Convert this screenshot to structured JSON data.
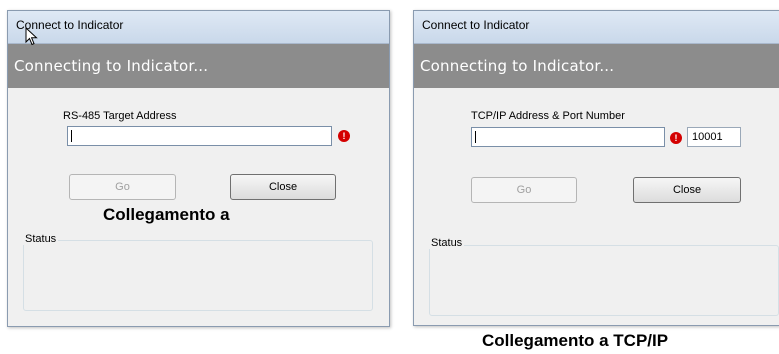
{
  "left_dialog": {
    "title": "Connect to Indicator",
    "header": "Connecting to Indicator...",
    "field_label": "RS-485 Target Address",
    "address_value": "",
    "go_label": "Go",
    "close_label": "Close",
    "status_label": "Status"
  },
  "right_dialog": {
    "title": "Connect to Indicator",
    "header": "Connecting to Indicator...",
    "field_label": "TCP/IP Address & Port Number",
    "address_value": "",
    "port_value": "10001",
    "go_label": "Go",
    "close_label": "Close",
    "status_label": "Status"
  },
  "captions": {
    "left": "Collegamento a",
    "right": "Collegamento a TCP/IP"
  },
  "icons": {
    "error": "error-icon",
    "cursor": "mouse-pointer-icon"
  },
  "colors": {
    "header_band": "#8c8c8c",
    "error_red": "#d40000"
  }
}
